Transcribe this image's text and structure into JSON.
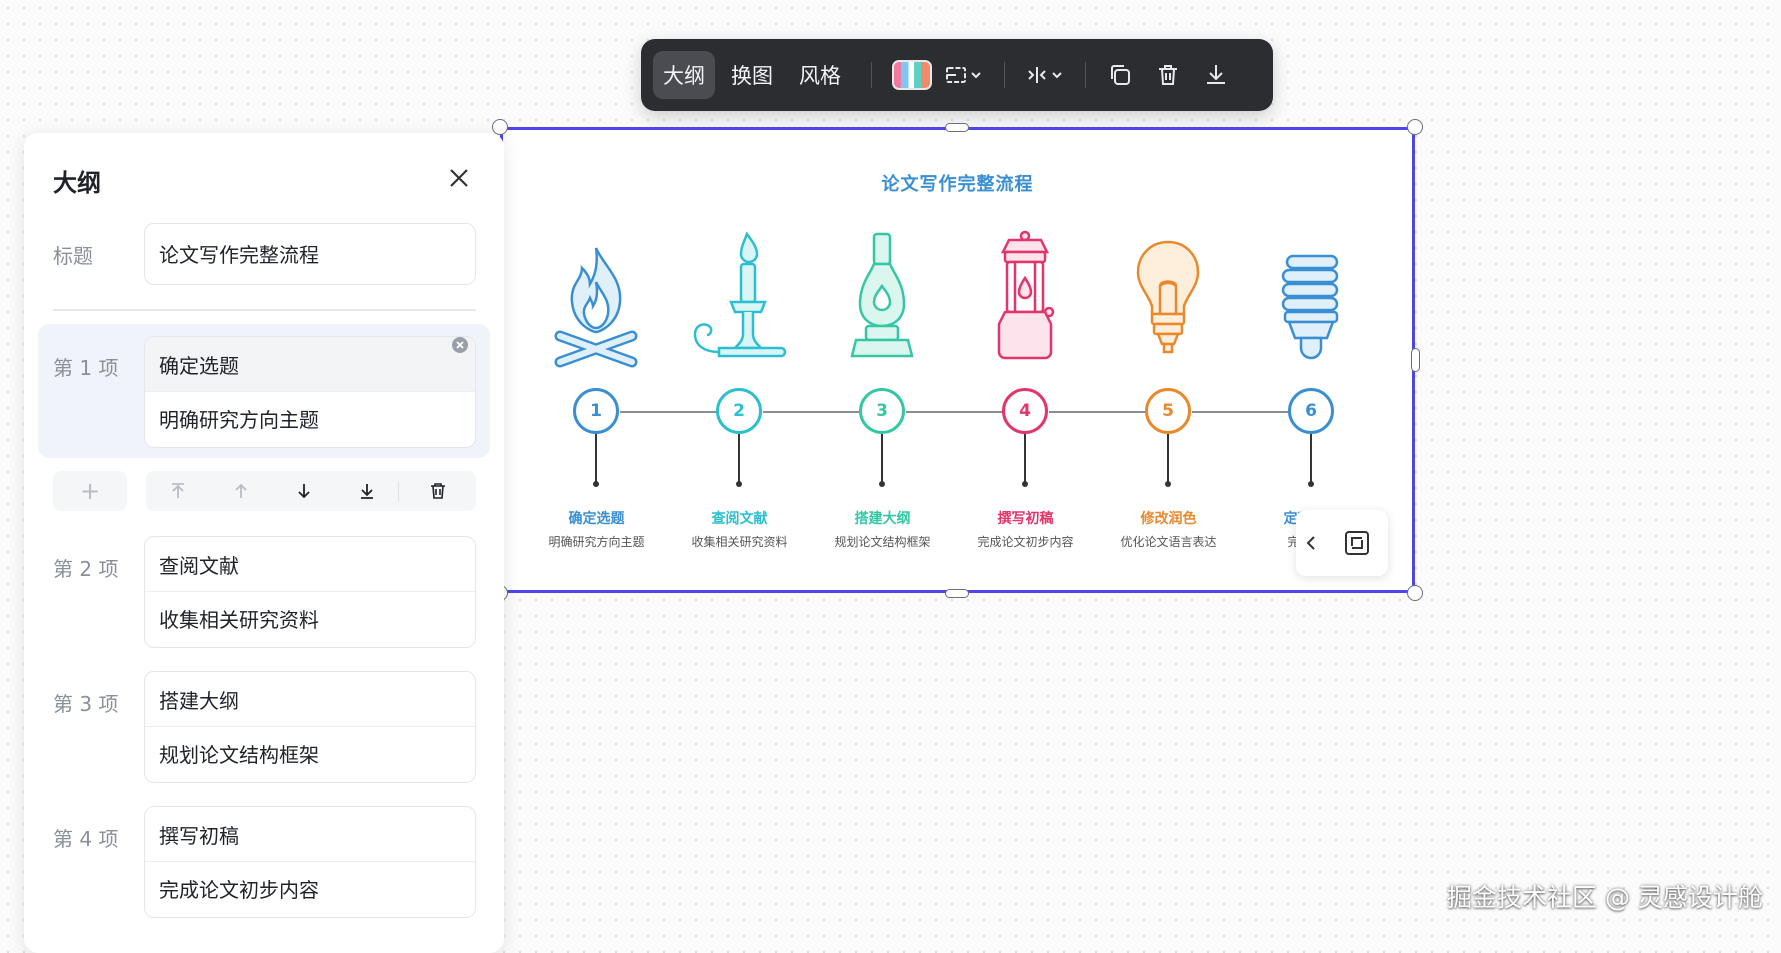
{
  "toolbar": {
    "outline_label": "大纲",
    "swap_image_label": "换图",
    "style_label": "风格"
  },
  "infographic": {
    "title": "论文写作完整流程",
    "stages": [
      {
        "num": "1",
        "title": "确定选题",
        "desc": "明确研究方向主题",
        "color": "#3a8fd3",
        "icon": "campfire-icon"
      },
      {
        "num": "2",
        "title": "查阅文献",
        "desc": "收集相关研究资料",
        "color": "#2cbfcf",
        "icon": "candle-icon"
      },
      {
        "num": "3",
        "title": "搭建大纲",
        "desc": "规划论文结构框架",
        "color": "#34c7a4",
        "icon": "oil-lamp-icon"
      },
      {
        "num": "4",
        "title": "撰写初稿",
        "desc": "完成论文初步内容",
        "color": "#e2366a",
        "icon": "lantern-icon"
      },
      {
        "num": "5",
        "title": "修改润色",
        "desc": "优化论文语言表达",
        "color": "#e8892b",
        "icon": "light-bulb-icon"
      },
      {
        "num": "6",
        "title": "定稿提交",
        "desc": "完成论文",
        "color": "#3a8fd3",
        "icon": "energy-saving-bulb-icon"
      }
    ]
  },
  "panel": {
    "title": "大纲",
    "title_label": "标题",
    "title_value": "论文写作完整流程",
    "items": [
      {
        "label": "第 1 项",
        "name": "确定选题",
        "desc": "明确研究方向主题"
      },
      {
        "label": "第 2 项",
        "name": "查阅文献",
        "desc": "收集相关研究资料"
      },
      {
        "label": "第 3 项",
        "name": "搭建大纲",
        "desc": "规划论文结构框架"
      },
      {
        "label": "第 4 项",
        "name": "撰写初稿",
        "desc": "完成论文初步内容"
      }
    ],
    "add_symbol": "+"
  },
  "watermark": "掘金技术社区 @ 灵感设计舱"
}
